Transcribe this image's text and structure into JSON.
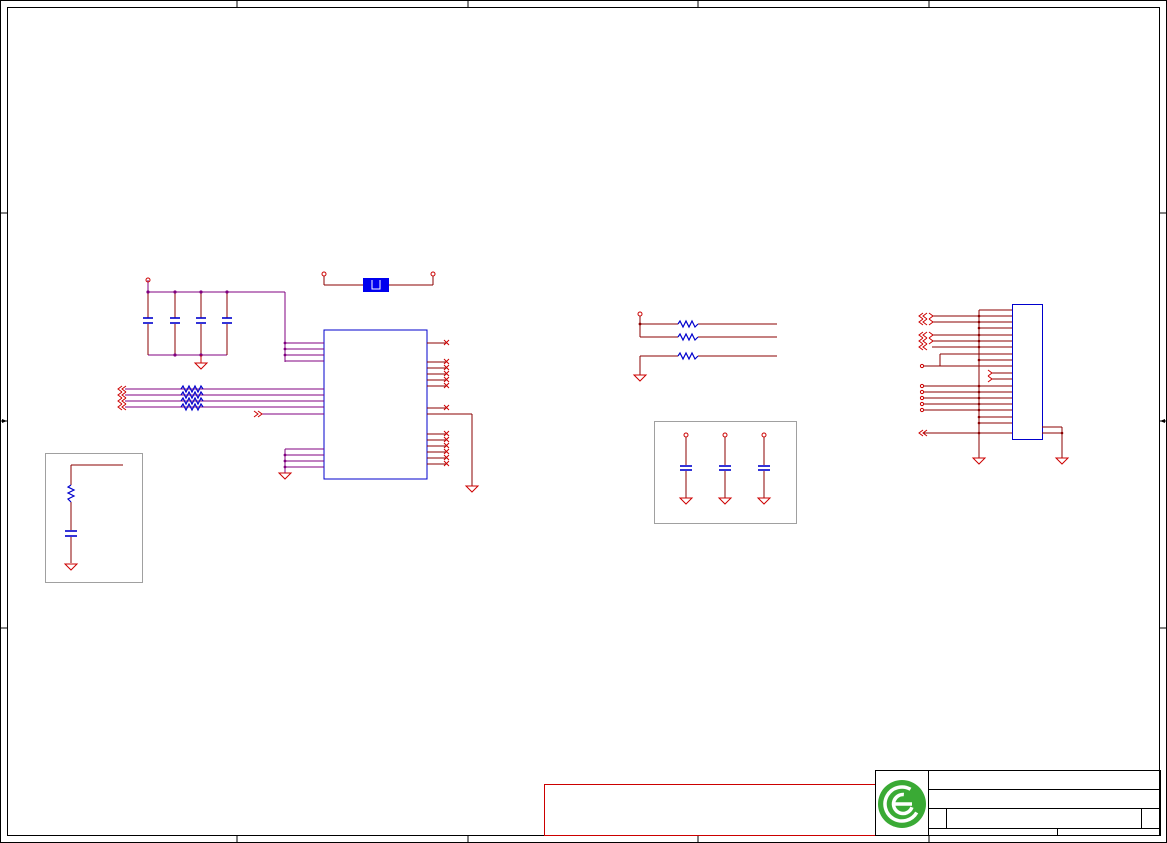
{
  "sheet": {
    "border_color": "#000000",
    "wire_color": "#8b0000",
    "bus_color": "#800080",
    "part_color": "#0000cd",
    "ground_color": "#cc0000",
    "group_box_color": "#a0a0a0",
    "notes_box_color": "#cc0000"
  },
  "title_block": {
    "logo_icon": "company-logo-icon",
    "logo_color": "#3aaa35"
  }
}
